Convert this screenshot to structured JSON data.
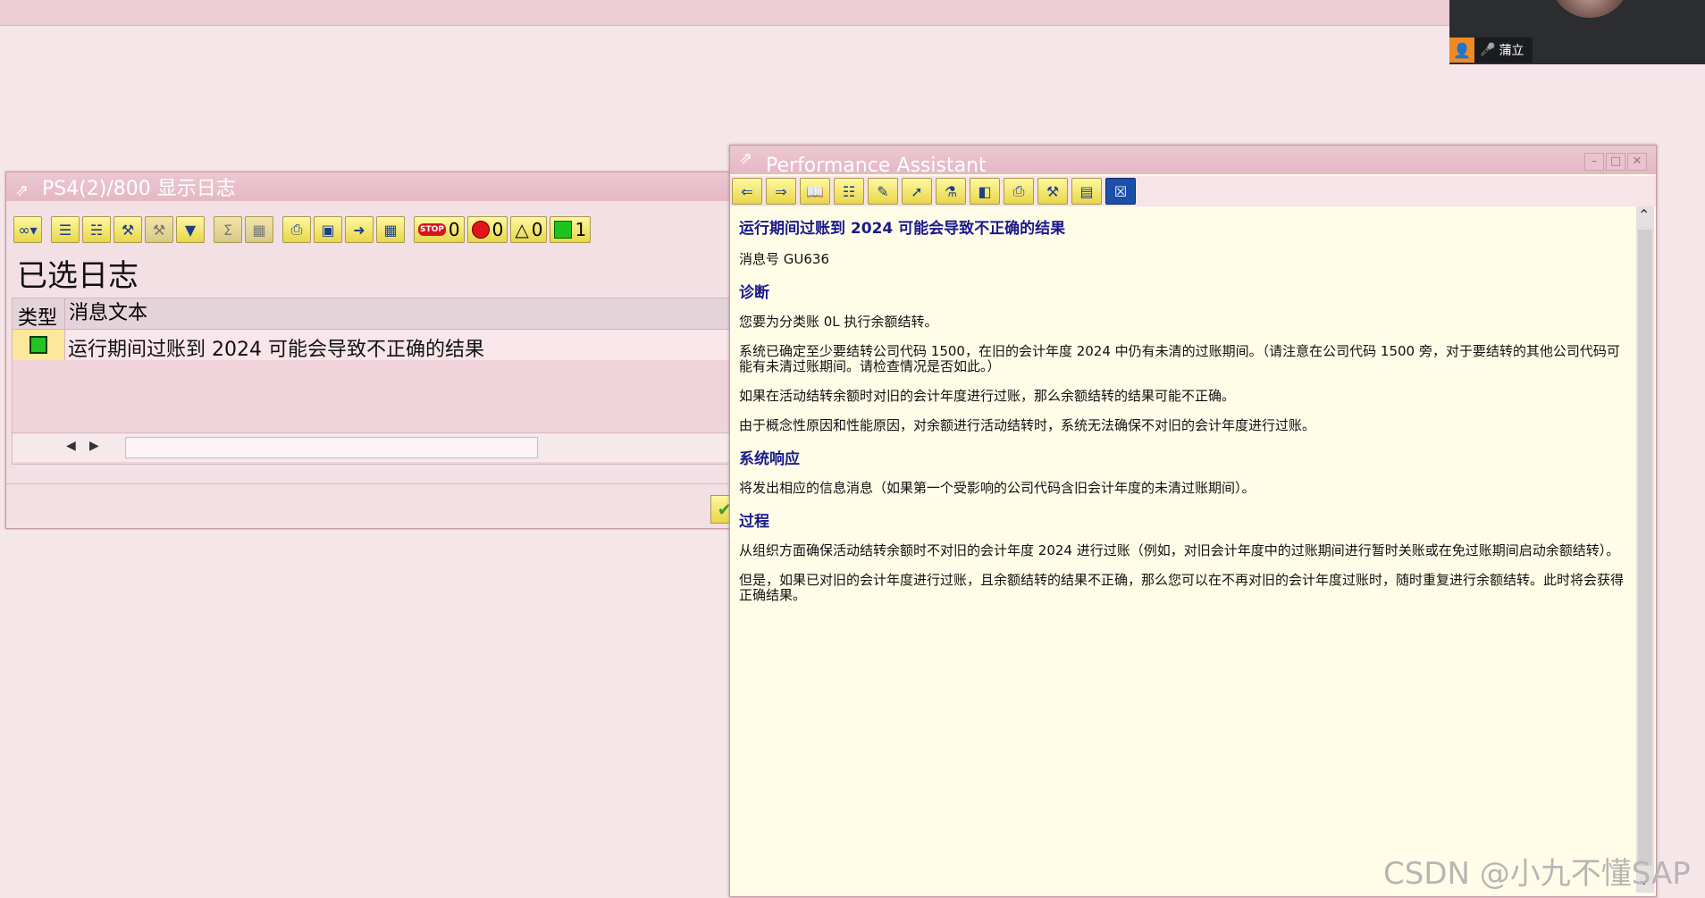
{
  "camera": {
    "user_icon": "person-icon",
    "mic_icon": "mic-icon",
    "name": "蒲立"
  },
  "log_window": {
    "title": "PS4(2)/800 显示日志",
    "heading": "已选日志",
    "toolbar": {
      "stop_count": "0",
      "error_count": "0",
      "warning_count": "0",
      "success_count": "1"
    },
    "columns": [
      "类型",
      "消息文本"
    ],
    "rows": [
      {
        "type": "success",
        "text": "运行期间过账到 2024 可能会导致不正确的结果"
      }
    ]
  },
  "perf_assistant": {
    "title": "Performance Assistant",
    "heading": "运行期间过账到 2024 可能会导致不正确的结果",
    "message_no": "消息号 GU636",
    "sections": {
      "diagnosis_title": "诊断",
      "diag_p1": "您要为分类账 0L 执行余额结转。",
      "diag_p2": "系统已确定至少要结转公司代码 1500，在旧的会计年度 2024 中仍有未清的过账期间。（请注意在公司代码 1500 旁，对于要结转的其他公司代码可能有未清过账期间。请检查情况是否如此。）",
      "diag_p3": "如果在活动结转余额时对旧的会计年度进行过账，那么余额结转的结果可能不正确。",
      "diag_p4": "由于概念性原因和性能原因，对余额进行活动结转时，系统无法确保不对旧的会计年度进行过账。",
      "response_title": "系统响应",
      "response_p1": "将发出相应的信息消息（如果第一个受影响的公司代码含旧会计年度的未清过账期间）。",
      "procedure_title": "过程",
      "proc_p1": "从组织方面确保活动结转余额时不对旧的会计年度 2024 进行过账（例如，对旧会计年度中的过账期间进行暂时关账或在免过账期间启动余额结转）。",
      "proc_p2": "但是，如果已对旧的会计年度进行过账，且余额结转的结果不正确，那么您可以在不再对旧的会计年度过账时，随时重复进行余额结转。此时将会获得正确结果。"
    }
  },
  "watermark": "CSDN @小九不懂SAP"
}
